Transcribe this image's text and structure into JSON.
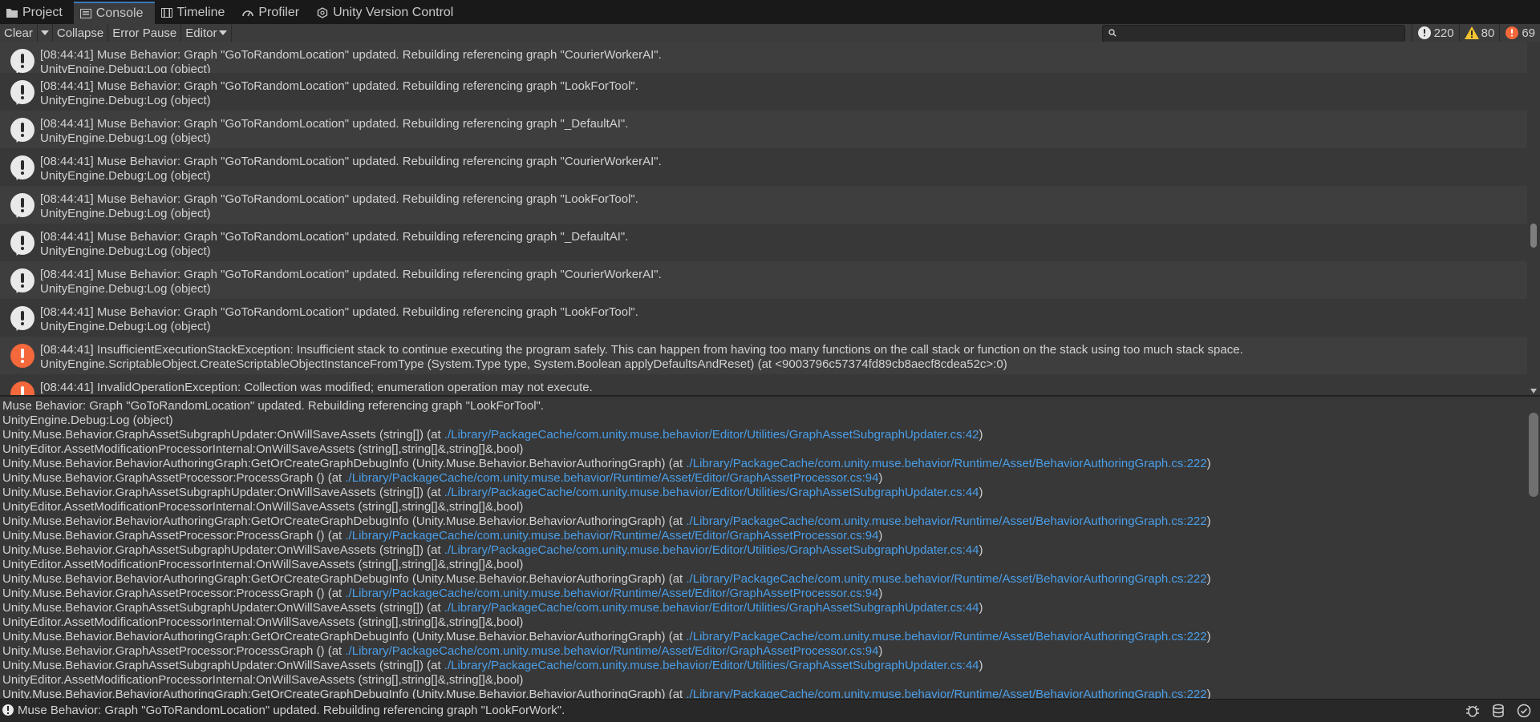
{
  "tabs": [
    {
      "label": "Project",
      "icon": "folder-icon"
    },
    {
      "label": "Console",
      "icon": "console-icon"
    },
    {
      "label": "Timeline",
      "icon": "timeline-icon"
    },
    {
      "label": "Profiler",
      "icon": "profiler-icon"
    },
    {
      "label": "Unity Version Control",
      "icon": "version-control-icon"
    }
  ],
  "toolbar": {
    "clear": "Clear",
    "collapse": "Collapse",
    "error_pause": "Error Pause",
    "editor": "Editor",
    "search_placeholder": ""
  },
  "counts": {
    "info": "220",
    "warning": "80",
    "error": "69"
  },
  "colors": {
    "info": "#e9e9e9",
    "warning": "#f4c430",
    "error": "#f4683c",
    "link": "#4a9ee8"
  },
  "log_entries": [
    {
      "type": "info",
      "line1": "[08:44:41] Muse Behavior: Graph \"GoToRandomLocation\" updated. Rebuilding referencing graph \"CourierWorkerAI\".",
      "line2": "UnityEngine.Debug:Log (object)"
    },
    {
      "type": "info",
      "line1": "[08:44:41] Muse Behavior: Graph \"GoToRandomLocation\" updated. Rebuilding referencing graph \"LookForTool\".",
      "line2": "UnityEngine.Debug:Log (object)"
    },
    {
      "type": "info",
      "line1": "[08:44:41] Muse Behavior: Graph \"GoToRandomLocation\" updated. Rebuilding referencing graph \"_DefaultAI\".",
      "line2": "UnityEngine.Debug:Log (object)"
    },
    {
      "type": "info",
      "line1": "[08:44:41] Muse Behavior: Graph \"GoToRandomLocation\" updated. Rebuilding referencing graph \"CourierWorkerAI\".",
      "line2": "UnityEngine.Debug:Log (object)"
    },
    {
      "type": "info",
      "line1": "[08:44:41] Muse Behavior: Graph \"GoToRandomLocation\" updated. Rebuilding referencing graph \"LookForTool\".",
      "line2": "UnityEngine.Debug:Log (object)"
    },
    {
      "type": "info",
      "line1": "[08:44:41] Muse Behavior: Graph \"GoToRandomLocation\" updated. Rebuilding referencing graph \"_DefaultAI\".",
      "line2": "UnityEngine.Debug:Log (object)"
    },
    {
      "type": "info",
      "line1": "[08:44:41] Muse Behavior: Graph \"GoToRandomLocation\" updated. Rebuilding referencing graph \"CourierWorkerAI\".",
      "line2": "UnityEngine.Debug:Log (object)"
    },
    {
      "type": "info",
      "line1": "[08:44:41] Muse Behavior: Graph \"GoToRandomLocation\" updated. Rebuilding referencing graph \"LookForTool\".",
      "line2": "UnityEngine.Debug:Log (object)"
    },
    {
      "type": "error",
      "line1": "[08:44:41] InsufficientExecutionStackException: Insufficient stack to continue executing the program safely. This can happen from having too many functions on the call stack or function on the stack using too much stack space.",
      "line2": "UnityEngine.ScriptableObject.CreateScriptableObjectInstanceFromType (System.Type type, System.Boolean applyDefaultsAndReset) (at <9003796c57374fd89cb8aecf8cdea52c>:0)"
    },
    {
      "type": "error",
      "line1": "[08:44:41] InvalidOperationException: Collection was modified; enumeration operation may not execute.",
      "line2": ""
    }
  ],
  "detail_lines": [
    {
      "text": "Muse Behavior: Graph \"GoToRandomLocation\" updated. Rebuilding referencing graph \"LookForTool\".",
      "link": ""
    },
    {
      "text": "UnityEngine.Debug:Log (object)",
      "link": ""
    },
    {
      "text": "Unity.Muse.Behavior.GraphAssetSubgraphUpdater:OnWillSaveAssets (string[]) (at ",
      "link": "./Library/PackageCache/com.unity.muse.behavior/Editor/Utilities/GraphAssetSubgraphUpdater.cs:42",
      "tail": ")"
    },
    {
      "text": "UnityEditor.AssetModificationProcessorInternal:OnWillSaveAssets (string[],string[]&,string[]&,bool)",
      "link": ""
    },
    {
      "text": "Unity.Muse.Behavior.BehaviorAuthoringGraph:GetOrCreateGraphDebugInfo (Unity.Muse.Behavior.BehaviorAuthoringGraph) (at ",
      "link": "./Library/PackageCache/com.unity.muse.behavior/Runtime/Asset/BehaviorAuthoringGraph.cs:222",
      "tail": ")"
    },
    {
      "text": "Unity.Muse.Behavior.GraphAssetProcessor:ProcessGraph () (at ",
      "link": "./Library/PackageCache/com.unity.muse.behavior/Runtime/Asset/Editor/GraphAssetProcessor.cs:94",
      "tail": ")"
    },
    {
      "text": "Unity.Muse.Behavior.GraphAssetSubgraphUpdater:OnWillSaveAssets (string[]) (at ",
      "link": "./Library/PackageCache/com.unity.muse.behavior/Editor/Utilities/GraphAssetSubgraphUpdater.cs:44",
      "tail": ")"
    },
    {
      "text": "UnityEditor.AssetModificationProcessorInternal:OnWillSaveAssets (string[],string[]&,string[]&,bool)",
      "link": ""
    },
    {
      "text": "Unity.Muse.Behavior.BehaviorAuthoringGraph:GetOrCreateGraphDebugInfo (Unity.Muse.Behavior.BehaviorAuthoringGraph) (at ",
      "link": "./Library/PackageCache/com.unity.muse.behavior/Runtime/Asset/BehaviorAuthoringGraph.cs:222",
      "tail": ")"
    },
    {
      "text": "Unity.Muse.Behavior.GraphAssetProcessor:ProcessGraph () (at ",
      "link": "./Library/PackageCache/com.unity.muse.behavior/Runtime/Asset/Editor/GraphAssetProcessor.cs:94",
      "tail": ")"
    },
    {
      "text": "Unity.Muse.Behavior.GraphAssetSubgraphUpdater:OnWillSaveAssets (string[]) (at ",
      "link": "./Library/PackageCache/com.unity.muse.behavior/Editor/Utilities/GraphAssetSubgraphUpdater.cs:44",
      "tail": ")"
    },
    {
      "text": "UnityEditor.AssetModificationProcessorInternal:OnWillSaveAssets (string[],string[]&,string[]&,bool)",
      "link": ""
    },
    {
      "text": "Unity.Muse.Behavior.BehaviorAuthoringGraph:GetOrCreateGraphDebugInfo (Unity.Muse.Behavior.BehaviorAuthoringGraph) (at ",
      "link": "./Library/PackageCache/com.unity.muse.behavior/Runtime/Asset/BehaviorAuthoringGraph.cs:222",
      "tail": ")"
    },
    {
      "text": "Unity.Muse.Behavior.GraphAssetProcessor:ProcessGraph () (at ",
      "link": "./Library/PackageCache/com.unity.muse.behavior/Runtime/Asset/Editor/GraphAssetProcessor.cs:94",
      "tail": ")"
    },
    {
      "text": "Unity.Muse.Behavior.GraphAssetSubgraphUpdater:OnWillSaveAssets (string[]) (at ",
      "link": "./Library/PackageCache/com.unity.muse.behavior/Editor/Utilities/GraphAssetSubgraphUpdater.cs:44",
      "tail": ")"
    },
    {
      "text": "UnityEditor.AssetModificationProcessorInternal:OnWillSaveAssets (string[],string[]&,string[]&,bool)",
      "link": ""
    },
    {
      "text": "Unity.Muse.Behavior.BehaviorAuthoringGraph:GetOrCreateGraphDebugInfo (Unity.Muse.Behavior.BehaviorAuthoringGraph) (at ",
      "link": "./Library/PackageCache/com.unity.muse.behavior/Runtime/Asset/BehaviorAuthoringGraph.cs:222",
      "tail": ")"
    },
    {
      "text": "Unity.Muse.Behavior.GraphAssetProcessor:ProcessGraph () (at ",
      "link": "./Library/PackageCache/com.unity.muse.behavior/Runtime/Asset/Editor/GraphAssetProcessor.cs:94",
      "tail": ")"
    },
    {
      "text": "Unity.Muse.Behavior.GraphAssetSubgraphUpdater:OnWillSaveAssets (string[]) (at ",
      "link": "./Library/PackageCache/com.unity.muse.behavior/Editor/Utilities/GraphAssetSubgraphUpdater.cs:44",
      "tail": ")"
    },
    {
      "text": "UnityEditor.AssetModificationProcessorInternal:OnWillSaveAssets (string[],string[]&,string[]&,bool)",
      "link": ""
    },
    {
      "text": "Unity.Muse.Behavior.BehaviorAuthoringGraph:GetOrCreateGraphDebugInfo (Unity.Muse.Behavior.BehaviorAuthoringGraph) (at ",
      "link": "./Library/PackageCache/com.unity.muse.behavior/Runtime/Asset/BehaviorAuthoringGraph.cs:222",
      "tail": ")"
    }
  ],
  "status_bar": {
    "message": "Muse Behavior: Graph \"GoToRandomLocation\" updated. Rebuilding referencing graph \"LookForWork\".",
    "icons": [
      "bug-icon",
      "database-icon",
      "check-circle-icon"
    ]
  }
}
